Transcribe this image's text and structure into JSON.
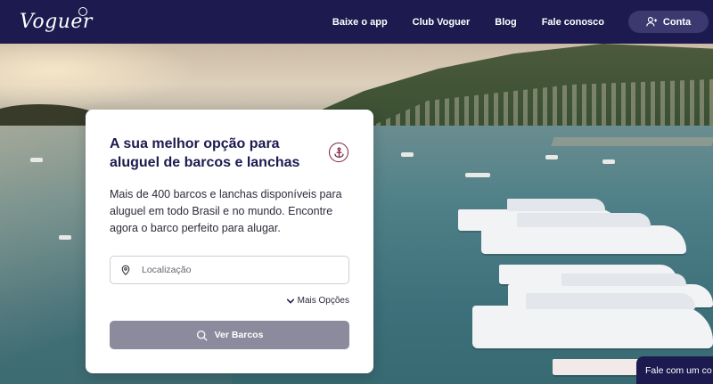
{
  "brand": {
    "logo_text": "Voguer"
  },
  "nav": {
    "links": [
      {
        "label": "Baixe o app"
      },
      {
        "label": "Club Voguer"
      },
      {
        "label": "Blog"
      },
      {
        "label": "Fale conosco"
      }
    ],
    "account_label": "Conta",
    "account_icon": "user-icon"
  },
  "search_card": {
    "title": "A sua melhor opção para aluguel de barcos e lanchas",
    "title_icon": "anchor-icon",
    "description": "Mais de 400 barcos e lanchas disponíveis para aluguel em todo Brasil e no mundo. Encontre agora o barco perfeito para alugar.",
    "location_placeholder": "Localização",
    "location_icon": "map-pin-icon",
    "more_options_label": "Mais Opções",
    "submit_label": "Ver Barcos",
    "submit_icon": "search-icon"
  },
  "chat": {
    "label": "Fale com um co"
  },
  "colors": {
    "nav_bg": "#1c1a4f",
    "title": "#1c1a4f",
    "anchor": "#7a1f3d",
    "button_bg": "#8c8b9d",
    "account_bg": "#3a3970"
  }
}
